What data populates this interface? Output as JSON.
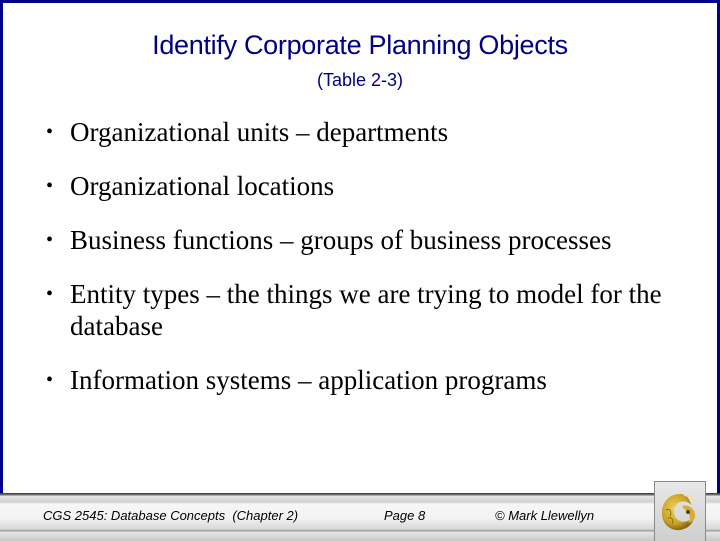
{
  "slide": {
    "title": "Identify Corporate Planning Objects",
    "subtitle": "(Table 2-3)",
    "bullets": [
      {
        "text": "Organizational units – departments"
      },
      {
        "text": "Organizational locations"
      },
      {
        "text": "Business functions – groups of business processes"
      },
      {
        "text": "Entity types – the things we are trying to model for the database"
      },
      {
        "text": "Information systems – application programs"
      }
    ],
    "bullet_glyph": "•"
  },
  "footer": {
    "course": "CGS 2545: Database Concepts  (Chapter 2)",
    "page": "Page 8",
    "copyright": "© Mark Llewellyn",
    "logo_icon": "pegasus-logo-icon"
  },
  "colors": {
    "frame": "#00008b",
    "title": "#000080",
    "logo_gold": "#c9a227"
  }
}
